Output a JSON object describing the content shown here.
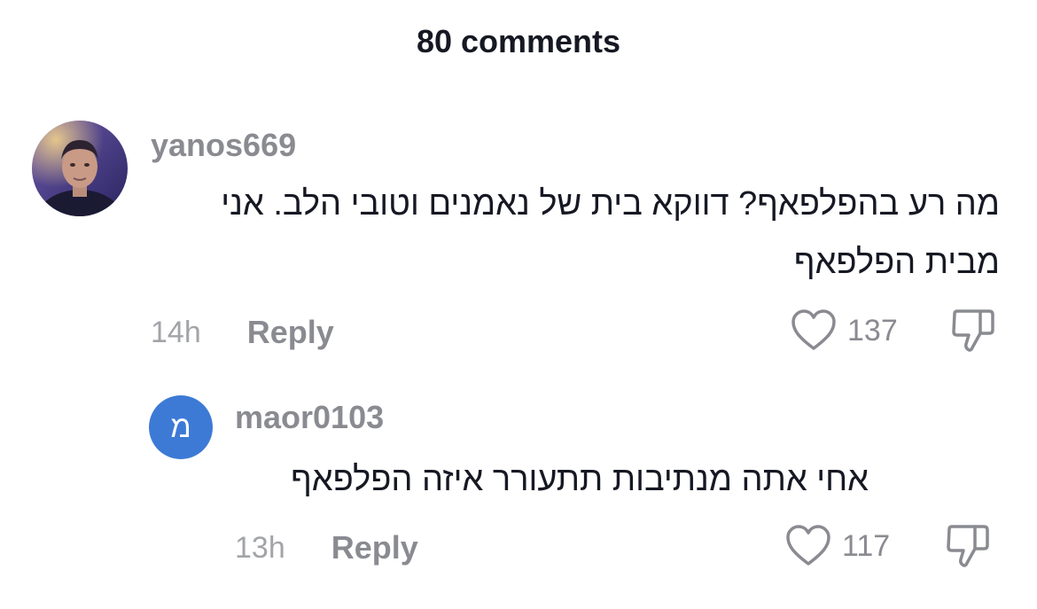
{
  "header": {
    "title": "80 comments"
  },
  "comments": [
    {
      "username": "yanos669",
      "text": "מה רע בהפלפאף? דווקא בית של נאמנים וטובי הלב. אני מבית הפלפאף",
      "time": "14h",
      "reply_label": "Reply",
      "likes": "137",
      "avatar": "user-photo"
    },
    {
      "username": "maor0103",
      "avatar_letter": "מ",
      "avatar_color": "#3d7ad6",
      "text": "אחי אתה מנתיבות תתעורר איזה הפלפאף",
      "time": "13h",
      "reply_label": "Reply",
      "likes": "117"
    }
  ],
  "icons": {
    "like": "heart-outline-icon",
    "dislike": "thumbs-down-outline-icon"
  }
}
